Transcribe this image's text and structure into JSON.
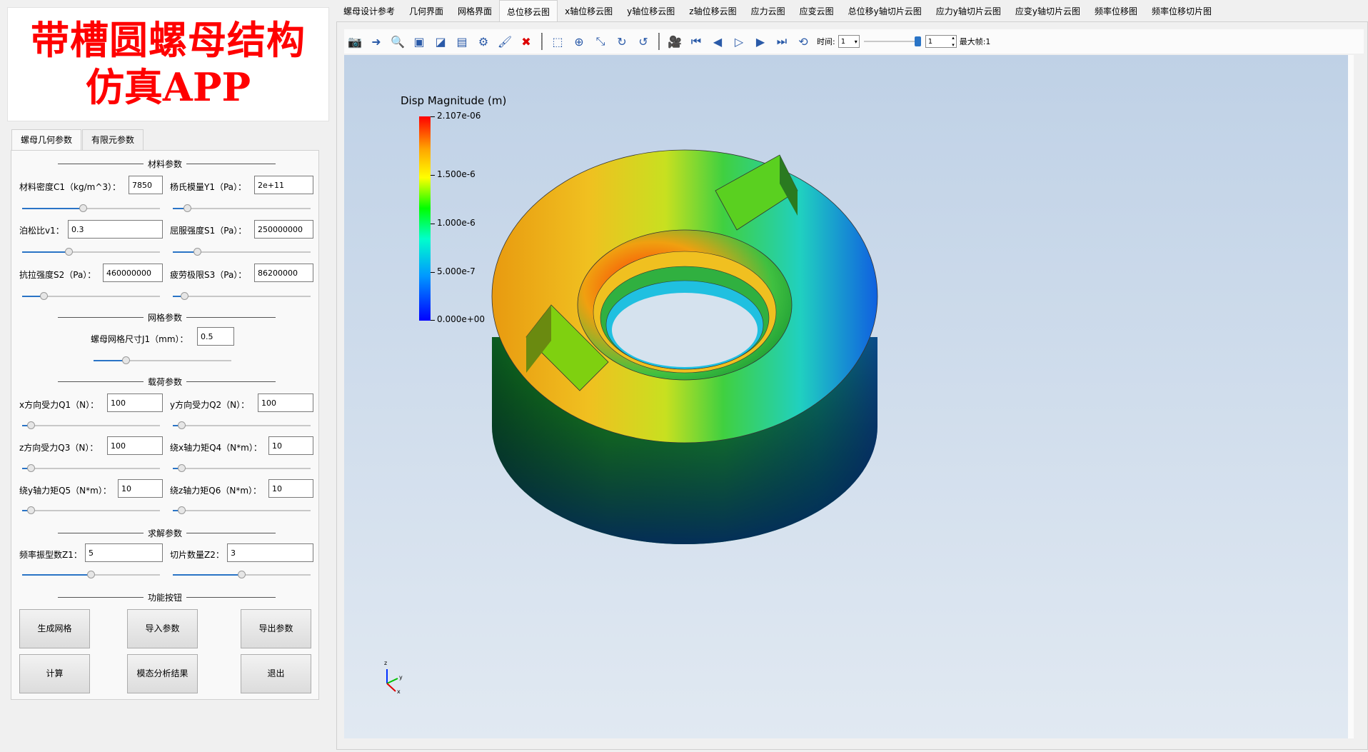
{
  "banner": {
    "line1": "带槽圆螺母结构",
    "line2": "仿真APP"
  },
  "left_tabs": [
    "螺母几何参数",
    "有限元参数"
  ],
  "sections": {
    "material": "材料参数",
    "mesh": "网格参数",
    "load": "载荷参数",
    "solve": "求解参数",
    "function": "功能按钮"
  },
  "fields": {
    "density": {
      "label": "材料密度C1（kg/m^3）：",
      "value": "7850"
    },
    "youngs": {
      "label": "杨氏模量Y1（Pa）：",
      "value": "2e+11"
    },
    "poisson": {
      "label": "泊松比v1：",
      "value": "0.3"
    },
    "yield": {
      "label": "屈服强度S1（Pa）：",
      "value": "250000000"
    },
    "tensile": {
      "label": "抗拉强度S2（Pa）：",
      "value": "460000000"
    },
    "fatigue": {
      "label": "疲劳极限S3（Pa）：",
      "value": "86200000"
    },
    "mesh_size": {
      "label": "螺母网格尺寸J1（mm）：",
      "value": "0.5"
    },
    "fx": {
      "label": "x方向受力Q1（N）：",
      "value": "100"
    },
    "fy": {
      "label": "y方向受力Q2（N）：",
      "value": "100"
    },
    "fz": {
      "label": "z方向受力Q3（N）：",
      "value": "100"
    },
    "mx": {
      "label": "绕x轴力矩Q4（N*m）：",
      "value": "10"
    },
    "my": {
      "label": "绕y轴力矩Q5（N*m）：",
      "value": "10"
    },
    "mz": {
      "label": "绕z轴力矩Q6（N*m）：",
      "value": "10"
    },
    "modes": {
      "label": "频率振型数Z1：",
      "value": "5"
    },
    "slices": {
      "label": "切片数量Z2：",
      "value": "3"
    }
  },
  "sliders": {
    "density": 0.44,
    "youngs": 0.08,
    "poisson": 0.33,
    "yield": 0.16,
    "tensile": 0.14,
    "fatigue": 0.06,
    "mesh_size": 0.22,
    "fx": 0.04,
    "fy": 0.04,
    "fz": 0.04,
    "mx": 0.04,
    "my": 0.04,
    "mz": 0.04,
    "modes": 0.5,
    "slices": 0.5
  },
  "buttons": {
    "gen_mesh": "生成网格",
    "import": "导入参数",
    "export": "导出参数",
    "compute": "计算",
    "modal": "模态分析结果",
    "exit": "退出"
  },
  "top_menu": [
    "螺母设计参考",
    "几何界面",
    "网格界面",
    "总位移云图",
    "x轴位移云图",
    "y轴位移云图",
    "z轴位移云图",
    "应力云图",
    "应变云图",
    "总位移y轴切片云图",
    "应力y轴切片云图",
    "应变y轴切片云图",
    "频率位移图",
    "频率位移切片图"
  ],
  "active_menu": "总位移云图",
  "toolbar": {
    "time_label": "时间:",
    "time_value": "1",
    "frame_value": "1",
    "max_frame_label": "最大帧:1"
  },
  "legend": {
    "title": "Disp Magnitude (m)",
    "ticks": [
      "2.107e-06",
      "1.500e-6",
      "1.000e-6",
      "5.000e-7",
      "0.000e+00"
    ],
    "colors": [
      "#ff0000",
      "#ffff00",
      "#00ff00",
      "#00ffff",
      "#0000ff"
    ]
  },
  "axes": {
    "x": "x",
    "y": "y",
    "z": "z"
  }
}
